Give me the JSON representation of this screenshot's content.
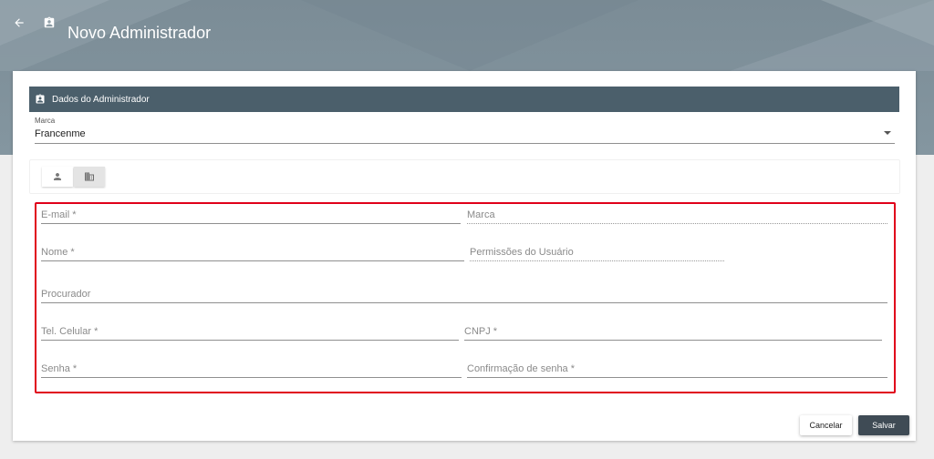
{
  "header": {
    "title": "Novo Administrador",
    "back_icon": "arrow-left-icon",
    "title_icon": "contact-badge-icon"
  },
  "section": {
    "title": "Dados do Administrador",
    "icon": "contact-badge-icon"
  },
  "brand_select": {
    "label": "Marca",
    "value": "Francenme"
  },
  "tabs": [
    {
      "icon": "person-icon"
    },
    {
      "icon": "building-icon"
    }
  ],
  "form": {
    "email": "E-mail *",
    "brand": "Marca",
    "name": "Nome *",
    "permissions": "Permissões do Usuário",
    "attorney": "Procurador",
    "mobile": "Tel. Celular *",
    "cnpj": "CNPJ *",
    "password": "Senha *",
    "password_confirm": "Confirmação de senha *"
  },
  "actions": {
    "cancel": "Cancelar",
    "save": "Salvar"
  },
  "colors": {
    "header_bg": "#7b8c96",
    "section_bar": "#4b5f6b",
    "primary_button": "#3f4b55",
    "highlight": "#e0001a"
  }
}
